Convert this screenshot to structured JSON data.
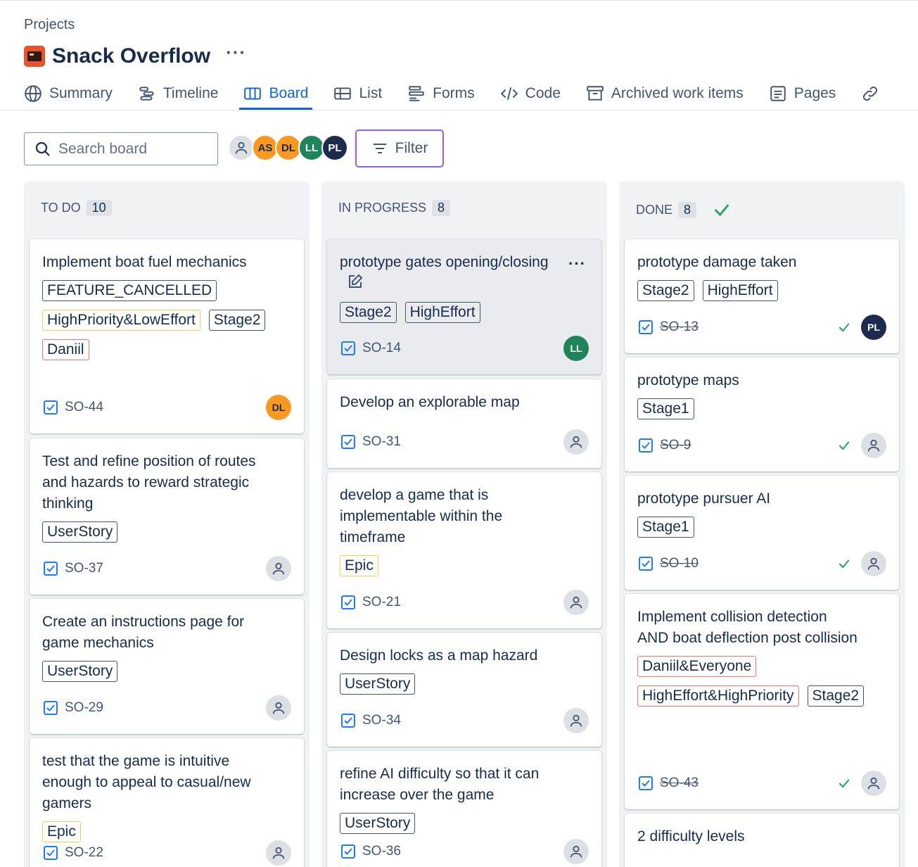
{
  "breadcrumb": "Projects",
  "project": {
    "name": "Snack Overflow",
    "more": "···"
  },
  "tabs": [
    {
      "label": "Summary",
      "icon": "globe-icon"
    },
    {
      "label": "Timeline",
      "icon": "timeline-icon"
    },
    {
      "label": "Board",
      "icon": "board-icon",
      "active": true
    },
    {
      "label": "List",
      "icon": "list-icon"
    },
    {
      "label": "Forms",
      "icon": "forms-icon"
    },
    {
      "label": "Code",
      "icon": "code-icon"
    },
    {
      "label": "Archived work items",
      "icon": "archive-icon"
    },
    {
      "label": "Pages",
      "icon": "pages-icon"
    }
  ],
  "search": {
    "placeholder": "Search board"
  },
  "filter": {
    "label": "Filter"
  },
  "members": [
    {
      "initials": "AS",
      "color": "#f79a1f"
    },
    {
      "initials": "DL",
      "color": "#f79a1f"
    },
    {
      "initials": "LL",
      "color": "#1f845a"
    },
    {
      "initials": "PL",
      "color": "#1d2b4f"
    }
  ],
  "columns": [
    {
      "name": "TO DO",
      "count": "10",
      "cards": [
        {
          "title": "Implement boat fuel mechanics",
          "labels": [
            {
              "text": "FEATURE_CANCELLED",
              "tone": "dark"
            },
            {
              "text": "HighPriority&LowEffort",
              "tone": "orange"
            },
            {
              "text": "Stage2",
              "tone": "dark"
            },
            {
              "text": "Daniil",
              "tone": "red"
            }
          ],
          "key": "SO-44",
          "assignee": {
            "initials": "DL",
            "color": "#f79a1f"
          }
        },
        {
          "title": "Test and refine position of routes and hazards to reward strategic thinking",
          "labels": [
            {
              "text": "UserStory",
              "tone": "dark"
            }
          ],
          "key": "SO-37",
          "assignee": null
        },
        {
          "title": "Create an instructions page for game mechanics",
          "labels": [
            {
              "text": "UserStory",
              "tone": "dark"
            }
          ],
          "key": "SO-29",
          "assignee": null
        },
        {
          "title": "test that the game is intuitive enough to appeal to casual/new gamers",
          "labels": [
            {
              "text": "Epic",
              "tone": "orange"
            }
          ],
          "key": "SO-22",
          "assignee": null
        }
      ]
    },
    {
      "name": "IN PROGRESS",
      "count": "8",
      "cards": [
        {
          "title": "prototype gates opening/closing",
          "labels": [
            {
              "text": "Stage2",
              "tone": "dark"
            },
            {
              "text": "HighEffort",
              "tone": "dark"
            }
          ],
          "key": "SO-14",
          "assignee": {
            "initials": "LL",
            "color": "#1f845a"
          },
          "hover": true,
          "more": "···"
        },
        {
          "title": "Develop an explorable map",
          "labels": [],
          "key": "SO-31",
          "assignee": null
        },
        {
          "title": "develop a game that is implementable within the timeframe",
          "labels": [
            {
              "text": "Epic",
              "tone": "orange"
            }
          ],
          "key": "SO-21",
          "assignee": null
        },
        {
          "title": "Design locks as a map hazard",
          "labels": [
            {
              "text": "UserStory",
              "tone": "dark"
            }
          ],
          "key": "SO-34",
          "assignee": null
        },
        {
          "title": "refine AI difficulty so that it can increase over the game",
          "labels": [
            {
              "text": "UserStory",
              "tone": "dark"
            }
          ],
          "key": "SO-36",
          "assignee": null
        }
      ]
    },
    {
      "name": "DONE",
      "count": "8",
      "complete": true,
      "cards": [
        {
          "title": "prototype damage taken",
          "labels": [
            {
              "text": "Stage2",
              "tone": "dark"
            },
            {
              "text": "HighEffort",
              "tone": "dark"
            }
          ],
          "key": "SO-13",
          "done": true,
          "assignee": {
            "initials": "PL",
            "color": "#1d2b4f"
          }
        },
        {
          "title": "prototype maps",
          "labels": [
            {
              "text": "Stage1",
              "tone": "dark"
            }
          ],
          "key": "SO-9",
          "done": true,
          "assignee": null
        },
        {
          "title": "prototype pursuer AI",
          "labels": [
            {
              "text": "Stage1",
              "tone": "dark"
            }
          ],
          "key": "SO-10",
          "done": true,
          "assignee": null
        },
        {
          "title": "Implement collision detection AND boat deflection post collision",
          "labels": [
            {
              "text": "Daniil&Everyone",
              "tone": "red"
            },
            {
              "text": "HighEffort&HighPriority",
              "tone": "red"
            },
            {
              "text": "Stage2",
              "tone": "dark"
            }
          ],
          "key": "SO-43",
          "done": true,
          "assignee": null
        },
        {
          "title": "2 difficulty levels",
          "labels": [],
          "key": "",
          "done": true,
          "assignee": null
        }
      ]
    }
  ]
}
